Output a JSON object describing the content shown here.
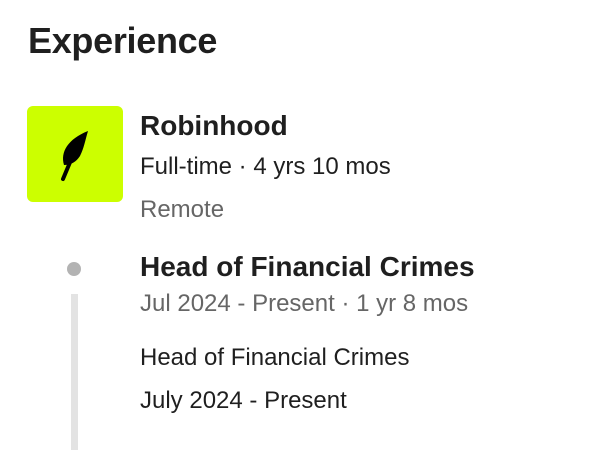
{
  "section": {
    "title": "Experience"
  },
  "company": {
    "name": "Robinhood",
    "employment": "Full-time · 4 yrs 10 mos",
    "location": "Remote",
    "logo": {
      "icon": "feather-icon",
      "background_color": "#ccff00",
      "icon_color": "#000000"
    }
  },
  "position": {
    "title": "Head of Financial Crimes",
    "dates": "Jul 2024 - Present · 1 yr 8 mos",
    "description": [
      "Head of Financial Crimes",
      "July 2024 - Present"
    ]
  }
}
